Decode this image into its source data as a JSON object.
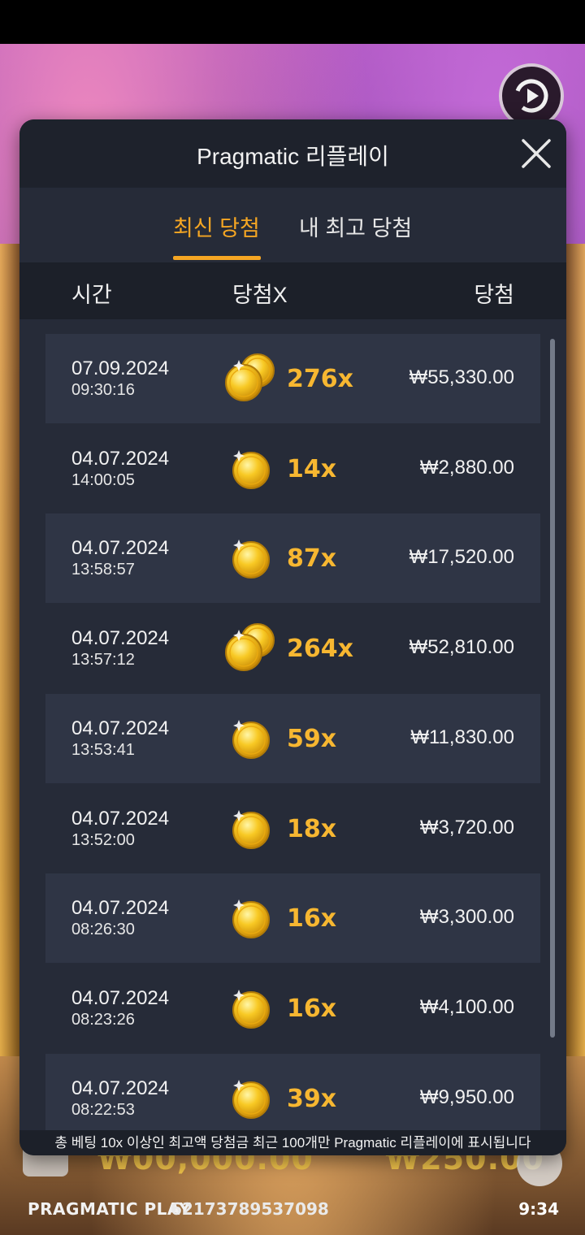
{
  "modal": {
    "title": "Pragmatic 리플레이",
    "close_icon": "close-icon",
    "tabs": [
      {
        "label": "최신 당첨",
        "active": true
      },
      {
        "label": "내 최고 당첨",
        "active": false
      }
    ],
    "columns": {
      "time": "시간",
      "multiplier": "당첨X",
      "win": "당첨"
    },
    "rows": [
      {
        "date": "07.09.2024",
        "time": "09:30:16",
        "coins": "double",
        "multiplier": "276x",
        "win": "₩55,330.00"
      },
      {
        "date": "04.07.2024",
        "time": "14:00:05",
        "coins": "single",
        "multiplier": "14x",
        "win": "₩2,880.00"
      },
      {
        "date": "04.07.2024",
        "time": "13:58:57",
        "coins": "single",
        "multiplier": "87x",
        "win": "₩17,520.00"
      },
      {
        "date": "04.07.2024",
        "time": "13:57:12",
        "coins": "double",
        "multiplier": "264x",
        "win": "₩52,810.00"
      },
      {
        "date": "04.07.2024",
        "time": "13:53:41",
        "coins": "single",
        "multiplier": "59x",
        "win": "₩11,830.00"
      },
      {
        "date": "04.07.2024",
        "time": "13:52:00",
        "coins": "single",
        "multiplier": "18x",
        "win": "₩3,720.00"
      },
      {
        "date": "04.07.2024",
        "time": "08:26:30",
        "coins": "single",
        "multiplier": "16x",
        "win": "₩3,300.00"
      },
      {
        "date": "04.07.2024",
        "time": "08:23:26",
        "coins": "single",
        "multiplier": "16x",
        "win": "₩4,100.00"
      },
      {
        "date": "04.07.2024",
        "time": "08:22:53",
        "coins": "single",
        "multiplier": "39x",
        "win": "₩9,950.00"
      }
    ],
    "footer_note": "총 베팅 10x 이상인 최고액 당첨금 최근 100개만 Pragmatic 리플레이에 표시됩니다"
  },
  "hud": {
    "balance_partial": "₩00,000.00",
    "bet_partial": "₩250.00",
    "brand": "PRAGMATIC PLAY",
    "session_id": "62173789537098",
    "clock": "9:34"
  },
  "colors": {
    "accent": "#f5a623",
    "multiplier": "#f7b731",
    "panel": "#262b38",
    "row_alt": "#2f3545"
  }
}
